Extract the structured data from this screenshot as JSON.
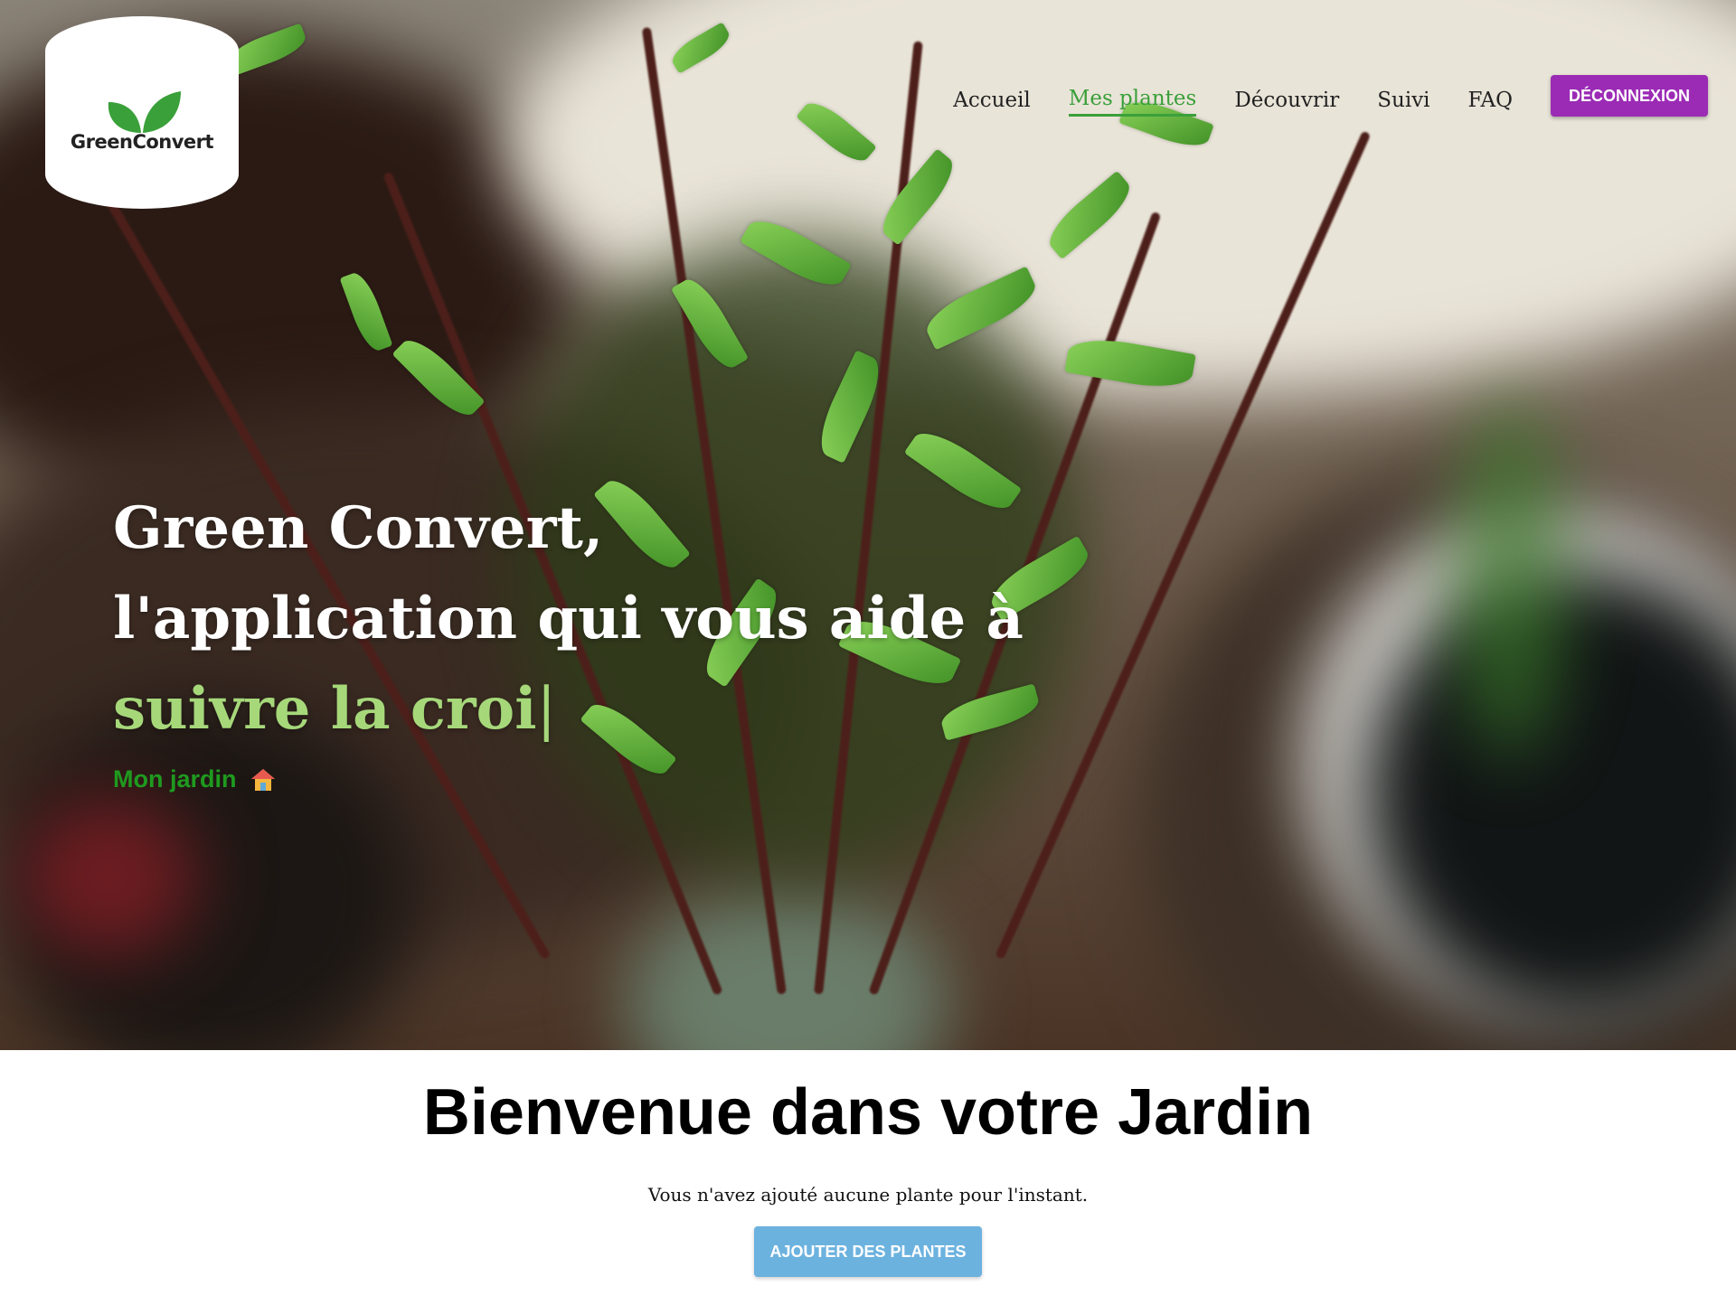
{
  "logo": {
    "text": "GreenConvert",
    "leaf_color": "#3aa03a"
  },
  "nav": {
    "items": [
      {
        "label": "Accueil",
        "active": false
      },
      {
        "label": "Mes plantes",
        "active": true
      },
      {
        "label": "Découvrir",
        "active": false
      },
      {
        "label": "Suivi",
        "active": false
      },
      {
        "label": "FAQ",
        "active": false
      }
    ],
    "logout_label": "DÉCONNEXION",
    "active_color": "#3aa03a",
    "logout_color": "#9b2bb5"
  },
  "hero": {
    "line1": "Green Convert,",
    "line2": "l'application qui vous aide à",
    "typed_text": "suivre la croi",
    "cursor": "|",
    "garden_link": "Mon jardin",
    "garden_icon": "house-icon",
    "typed_color": "#a6d87a",
    "garden_color": "#1f9a1f"
  },
  "main": {
    "title": "Bienvenue dans votre Jardin",
    "empty_message": "Vous n'avez ajouté aucune plante pour l'instant.",
    "add_button": "AJOUTER DES PLANTES",
    "add_button_color": "#6cb2df"
  }
}
